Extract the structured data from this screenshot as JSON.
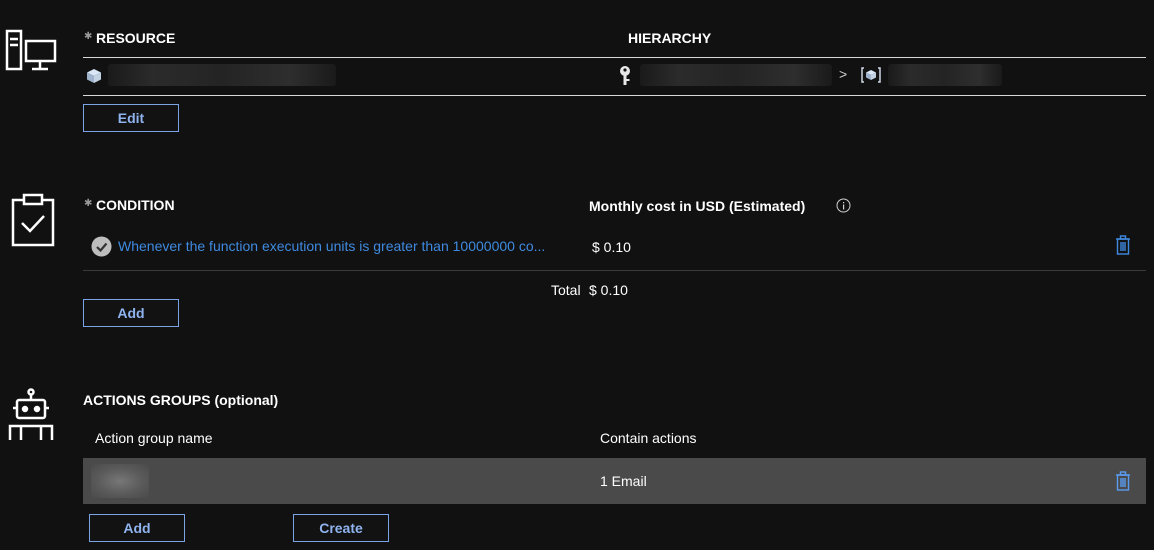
{
  "resource": {
    "header": "RESOURCE",
    "hierarchy_header": "HIERARCHY",
    "edit_label": "Edit",
    "breadcrumb_separator": ">"
  },
  "condition": {
    "header": "CONDITION",
    "cost_header": "Monthly cost in USD (Estimated)",
    "rows": [
      {
        "text": "Whenever the function execution units is greater than 10000000 co...",
        "cost": "$ 0.10"
      }
    ],
    "total_label": "Total",
    "total_value": "$ 0.10",
    "add_label": "Add"
  },
  "actions": {
    "header": "ACTIONS GROUPS (optional)",
    "columns": [
      "Action group name",
      "Contain actions"
    ],
    "rows": [
      {
        "name": "",
        "actions": "1 Email"
      }
    ],
    "add_label": "Add",
    "create_label": "Create"
  },
  "colors": {
    "background": "#111111",
    "link": "#3f8ae0",
    "button_border": "#7aa4e6",
    "selected_row": "#4a4a4a"
  }
}
